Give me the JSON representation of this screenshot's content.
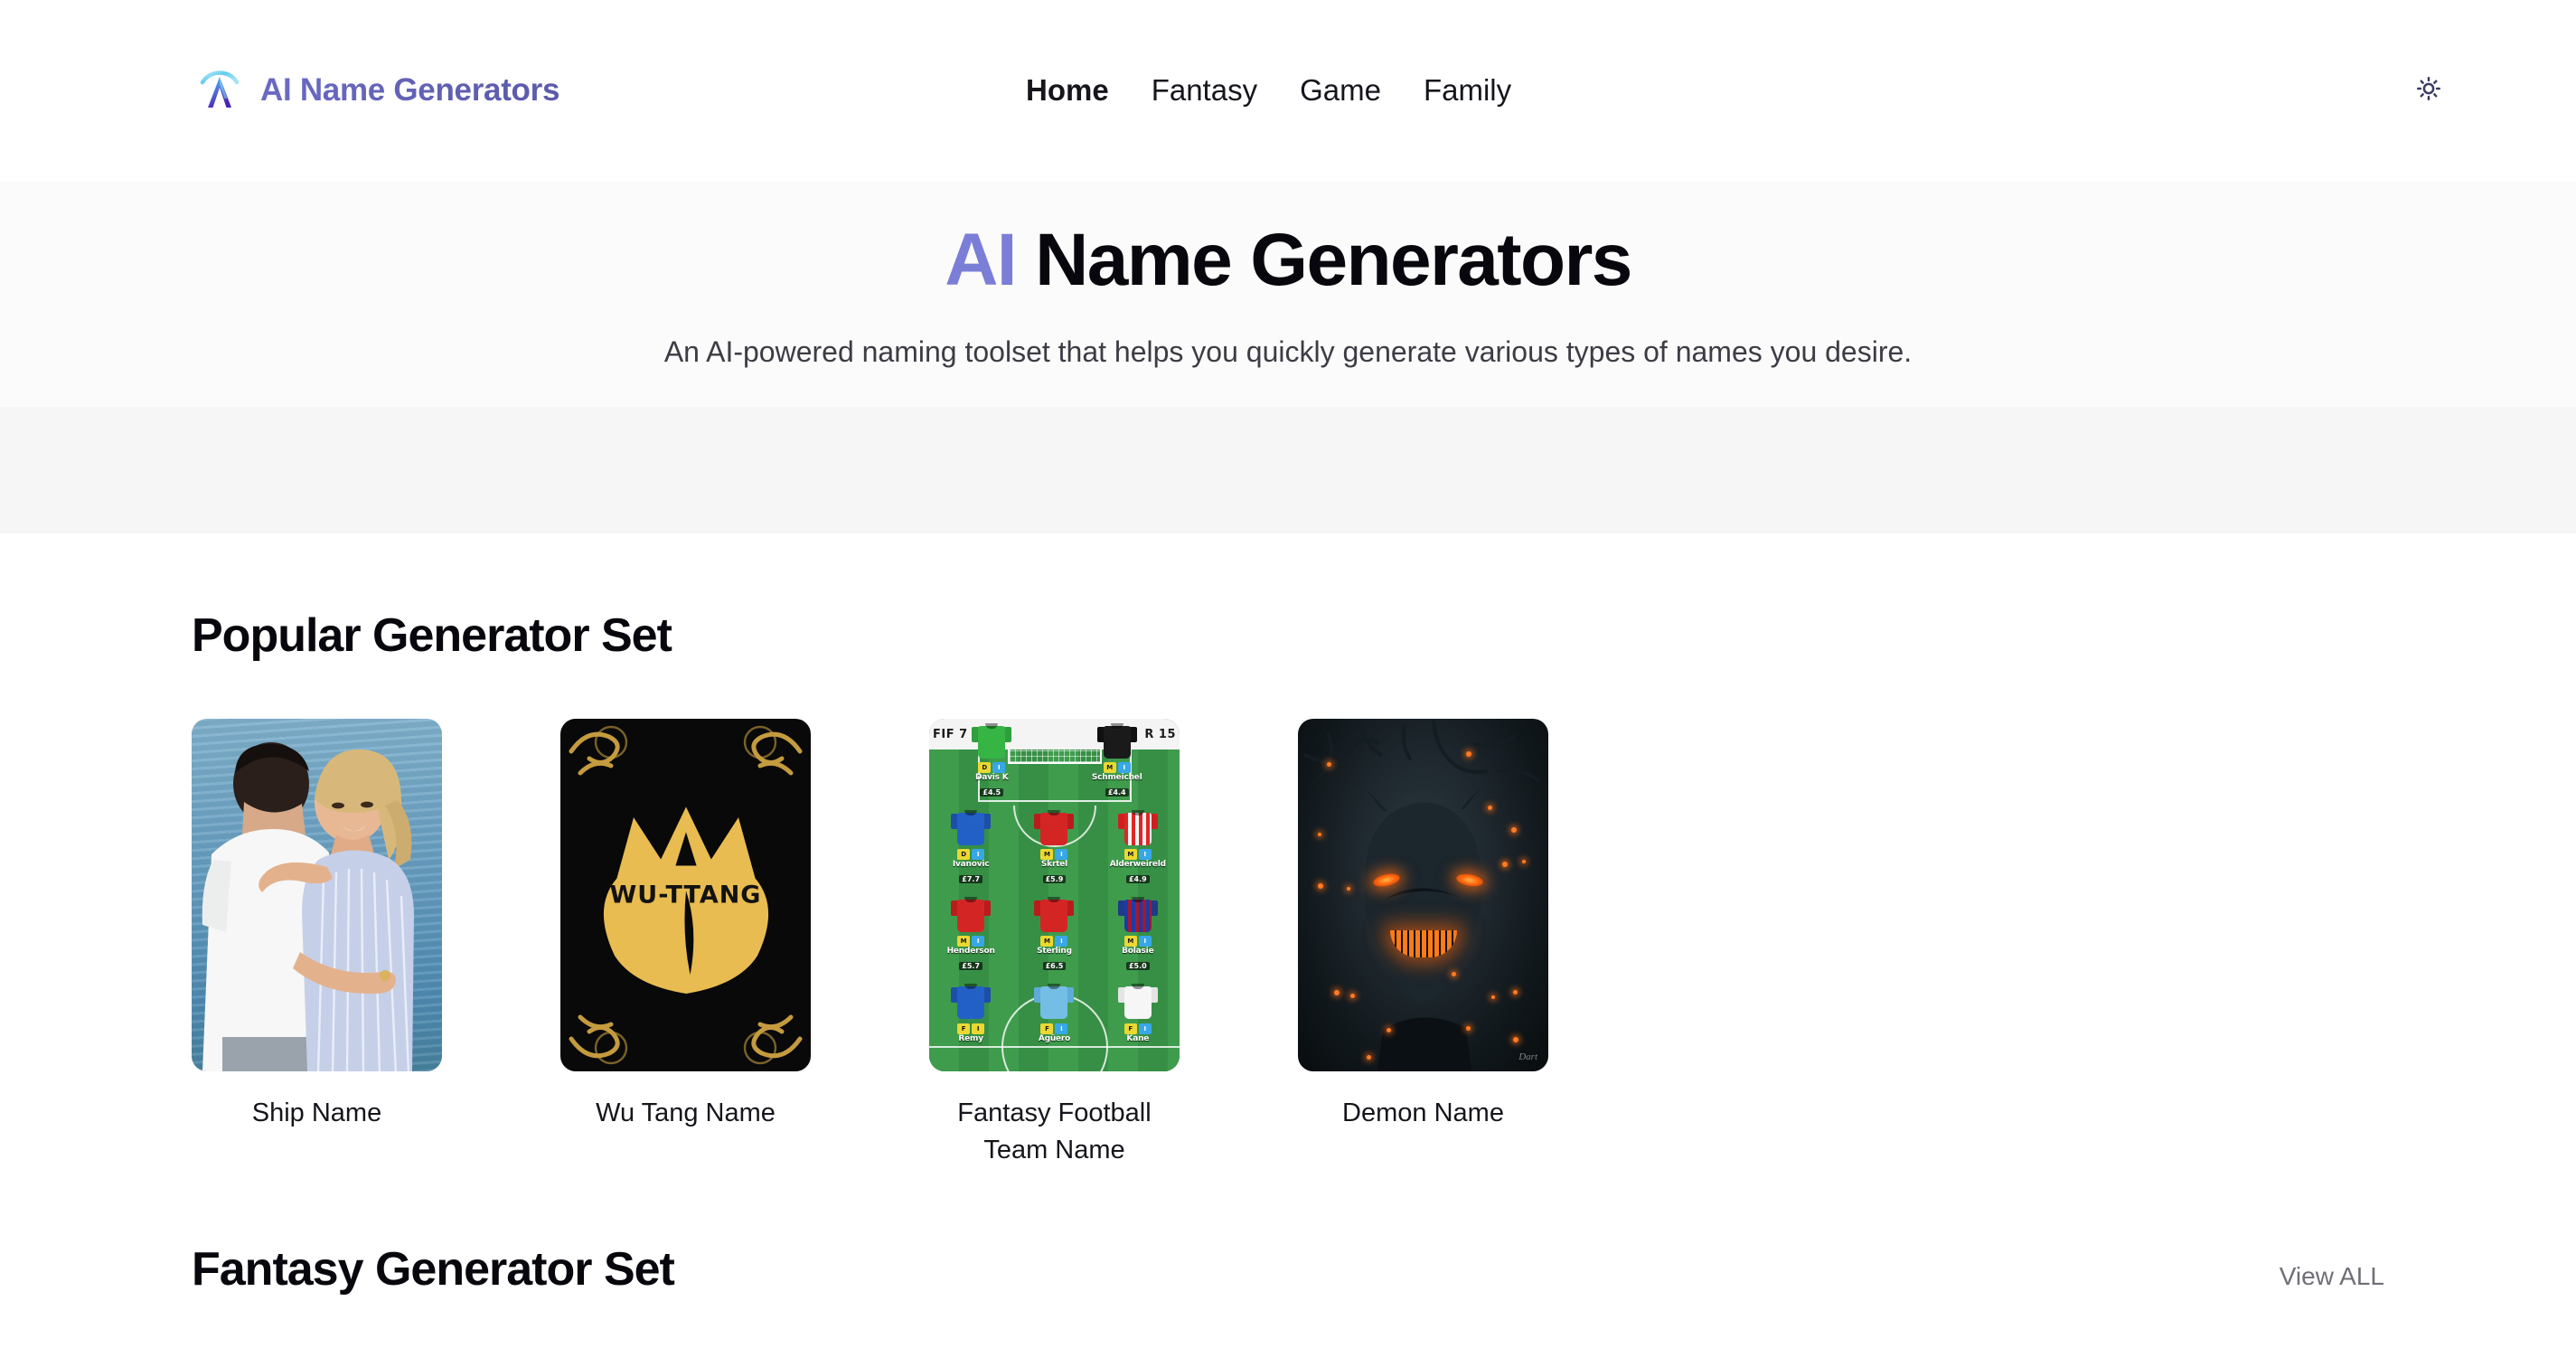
{
  "header": {
    "brand_name": "AI Name Generators",
    "logo_icon": "ai-arrow-logo",
    "nav": [
      {
        "label": "Home",
        "active": true
      },
      {
        "label": "Fantasy",
        "active": false
      },
      {
        "label": "Game",
        "active": false
      },
      {
        "label": "Family",
        "active": false
      }
    ],
    "theme_toggle_icon": "sun-icon",
    "brand_color": "#5b5bb0"
  },
  "hero": {
    "title_accent": "AI",
    "title_rest": " Name Generators",
    "subtitle": "An AI-powered naming toolset that helps you quickly generate various types of names you desire.",
    "accent_color": "#7b7ed6",
    "band_a_color": "#fbfbfb",
    "band_b_color": "#f6f6f6"
  },
  "popular_section": {
    "title": "Popular Generator Set",
    "cards": [
      {
        "label": "Ship Name",
        "thumb": "couple-by-the-sea-photo"
      },
      {
        "label": "Wu Tang Name",
        "thumb": "wu-tang-logo-gold-on-black"
      },
      {
        "label": "Fantasy Football Team Name",
        "thumb": "fantasy-football-lineup-pitch"
      },
      {
        "label": "Demon Name",
        "thumb": "dark-demon-glowing-eyes-art"
      }
    ]
  },
  "wu_tang_card": {
    "wordmark": "WU-TTANG",
    "logo_color": "#e8bc51",
    "background_color": "#09090a"
  },
  "football_card": {
    "board_left": "FIF    7",
    "board_right": "R 15",
    "rows": [
      [
        {
          "name": "Davis K",
          "price": "£4.5",
          "kit": "chelsea-blue",
          "pills": [
            "D",
            "I"
          ]
        },
        {
          "name": "Schmeichel",
          "price": "£4.4",
          "kit": "leicester-dark",
          "pills": [
            "M",
            "I"
          ]
        }
      ],
      [
        {
          "name": "Ivanovic",
          "price": "£7.7",
          "kit": "chelsea-blue",
          "pills": [
            "D",
            "I"
          ]
        },
        {
          "name": "Skrtel",
          "price": "£5.9",
          "kit": "liverpool-red",
          "pills": [
            "M",
            "I"
          ]
        },
        {
          "name": "Alderweireld",
          "price": "£4.9",
          "kit": "southampton-stripes",
          "pills": [
            "M",
            "I"
          ]
        }
      ],
      [
        {
          "name": "Henderson",
          "price": "£5.7",
          "kit": "liverpool-red",
          "pills": [
            "M",
            "I"
          ]
        },
        {
          "name": "Sterling",
          "price": "£6.5",
          "kit": "liverpool-red",
          "pills": [
            "M",
            "I"
          ]
        },
        {
          "name": "Bolasie",
          "price": "£5.0",
          "kit": "palace-stripes",
          "pills": [
            "M",
            "I"
          ]
        }
      ],
      [
        {
          "name": "Remy",
          "price": "",
          "kit": "chelsea-blue",
          "pills": [
            "F",
            "I"
          ]
        },
        {
          "name": "Agüero",
          "price": "",
          "kit": "man-city-sky",
          "pills": [
            "F",
            "I"
          ]
        },
        {
          "name": "Kane",
          "price": "",
          "kit": "tottenham-white",
          "pills": [
            "F",
            "I"
          ]
        }
      ]
    ],
    "goalkeeper_left_kit": "green-gk",
    "goalkeeper_right_kit": "black-gk"
  },
  "demon_card": {
    "signature": "Dart"
  },
  "fantasy_section": {
    "title": "Fantasy Generator Set",
    "view_all_label": "View ALL"
  }
}
